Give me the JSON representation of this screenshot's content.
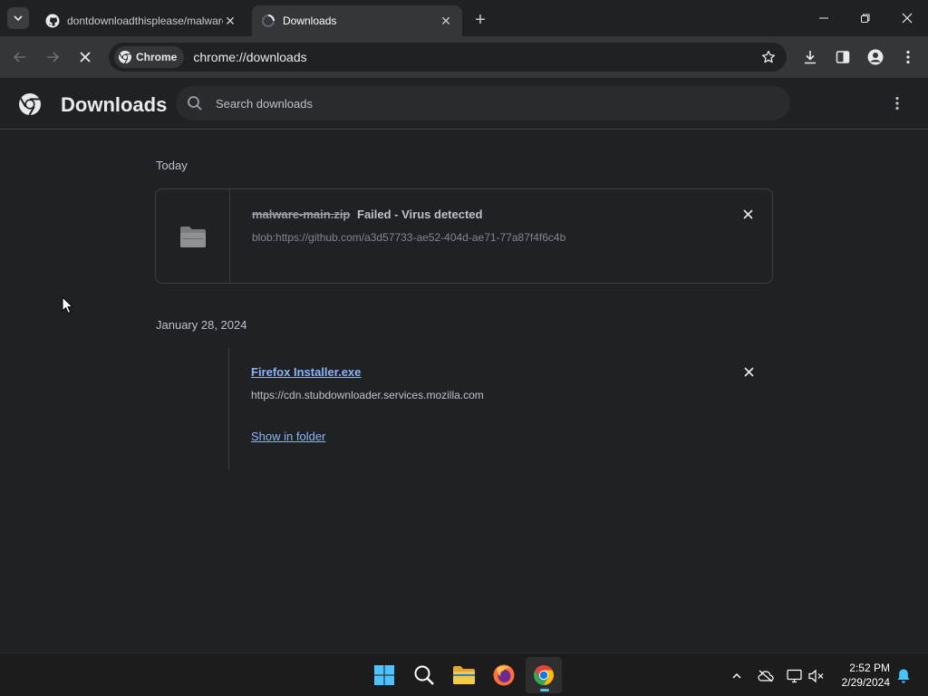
{
  "browser": {
    "tabs": [
      {
        "title": "dontdownloadthisplease/malware-main",
        "active": false
      },
      {
        "title": "Downloads",
        "active": true
      }
    ],
    "chip_label": "Chrome",
    "url": "chrome://downloads"
  },
  "downloads_page": {
    "title": "Downloads",
    "search_placeholder": "Search downloads",
    "groups": [
      {
        "date": "Today",
        "item": {
          "file_name": "malware-main.zip",
          "status": "Failed - Virus detected",
          "source": "blob:https://github.com/a3d57733-ae52-404d-ae71-77a87f4f6c4b"
        }
      },
      {
        "date": "January 28, 2024",
        "item": {
          "file_name": "Firefox Installer.exe",
          "source": "https://cdn.stubdownloader.services.mozilla.com",
          "action": "Show in folder"
        }
      }
    ]
  },
  "taskbar": {
    "time": "2:52 PM",
    "date": "2/29/2024"
  },
  "colors": {
    "background": "#202124",
    "toolbar": "#35363a",
    "link": "#8ab4f8",
    "taskbar": "#1c1c1c"
  }
}
